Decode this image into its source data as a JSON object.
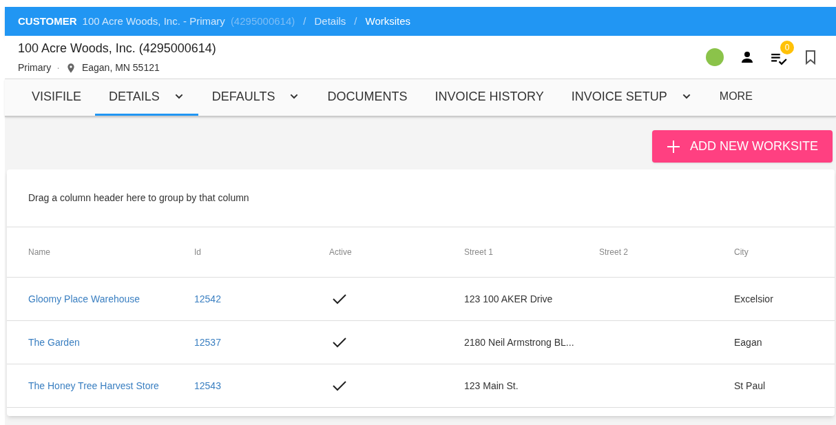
{
  "breadcrumb": {
    "section": "CUSTOMER",
    "separator": "/",
    "items": [
      {
        "label": "100 Acre Woods, Inc. - Primary",
        "note": "(4295000614)",
        "current": false
      },
      {
        "label": "Details",
        "current": false
      },
      {
        "label": "Worksites",
        "current": true
      }
    ]
  },
  "header": {
    "title": "100 Acre Woods, Inc. (4295000614)",
    "subtitle": "Primary",
    "dot": "·",
    "location": "Eagan, MN 55121",
    "task_count": "0"
  },
  "tabs": [
    {
      "label": "VISIFILE",
      "selected": false,
      "has_menu": false
    },
    {
      "label": "DETAILS",
      "selected": true,
      "has_menu": true
    },
    {
      "label": "DEFAULTS",
      "selected": false,
      "has_menu": true
    },
    {
      "label": "DOCUMENTS",
      "selected": false,
      "has_menu": false
    },
    {
      "label": "INVOICE HISTORY",
      "selected": false,
      "has_menu": false
    },
    {
      "label": "INVOICE SETUP",
      "selected": false,
      "has_menu": true
    },
    {
      "label": "MORE",
      "selected": false,
      "has_menu": false
    }
  ],
  "add_button": "ADD NEW WORKSITE",
  "table": {
    "group_hint": "Drag a column header here to group by that column",
    "columns": [
      "Name",
      "Id",
      "Active",
      "Street 1",
      "Street 2",
      "City"
    ],
    "rows": [
      {
        "name": "Gloomy Place Warehouse",
        "id": "12542",
        "active": true,
        "street_1": "123 100 AKER Drive",
        "city": "Excelsior"
      },
      {
        "name": "The Garden",
        "id": "12537",
        "active": true,
        "street_1": "2180 Neil Armstrong BL...",
        "city": "Eagan"
      },
      {
        "name": "The Honey Tree Harvest Store",
        "id": "12543",
        "active": true,
        "street_1": "123 Main St.",
        "city": "St Paul"
      }
    ]
  }
}
